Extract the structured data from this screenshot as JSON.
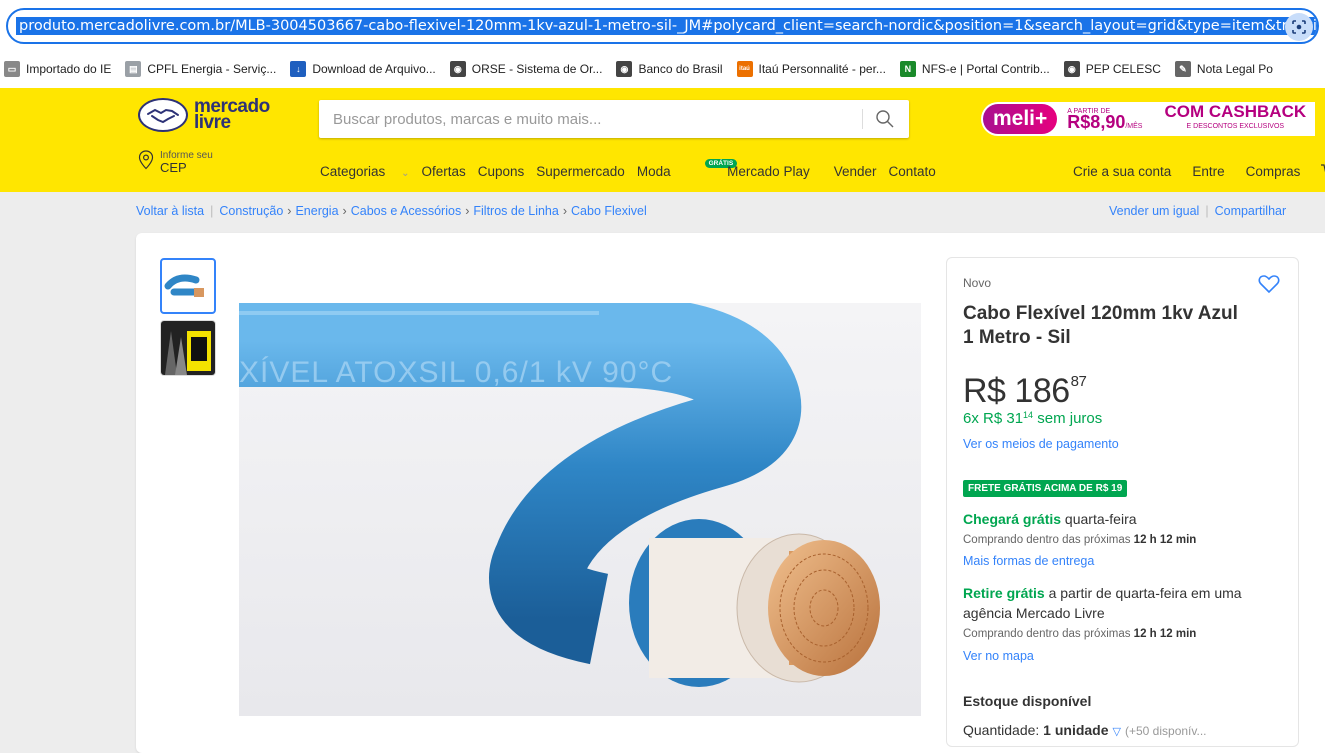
{
  "browser": {
    "url_start": "produto.mercadolivre.com.br/MLB-3004503667-cabo-flexivel-120mm-1kv-azul-1-metro-sil-_JM#polycard_client=search-nordic&position=1&search_layout=grid&type=item&tracking",
    "bookmarks": [
      {
        "label": "Importado do IE",
        "icon": "folder-icon",
        "color": "#888888"
      },
      {
        "label": "CPFL Energia - Serviç...",
        "icon": "page-icon",
        "color": "#9aa0a6"
      },
      {
        "label": "Download de Arquivo...",
        "icon": "download-icon",
        "color": "#1f5fbf"
      },
      {
        "label": "ORSE - Sistema de Or...",
        "icon": "globe-icon",
        "color": "#444444"
      },
      {
        "label": "Banco do Brasil",
        "icon": "globe-icon",
        "color": "#444444"
      },
      {
        "label": "Itaú Personnalité - per...",
        "icon": "itau-icon",
        "color": "#ec7000"
      },
      {
        "label": "NFS-e | Portal Contrib...",
        "icon": "nfse-icon",
        "color": "#1a8a2a"
      },
      {
        "label": "PEP CELESC",
        "icon": "globe-icon",
        "color": "#444444"
      },
      {
        "label": "Nota Legal Po",
        "icon": "nota-icon",
        "color": "#666666"
      }
    ]
  },
  "header": {
    "logo_line1": "mercado",
    "logo_line2": "livre",
    "search_placeholder": "Buscar produtos, marcas e muito mais...",
    "meli": {
      "tag": "meli+",
      "from": "A PARTIR DE",
      "price": "R$8,90",
      "per": "/MÊS",
      "cashback": "COM CASHBACK",
      "extra": "E DESCONTOS EXCLUSIVOS"
    },
    "cep_line1": "Informe seu",
    "cep_line2": "CEP",
    "nav": [
      "Categorias",
      "Ofertas",
      "Cupons",
      "Supermercado",
      "Moda",
      "Mercado Play",
      "Vender",
      "Contato"
    ],
    "gratis_badge": "GRÁTIS",
    "account": [
      "Crie a sua conta",
      "Entre",
      "Compras"
    ]
  },
  "breadcrumb": {
    "back": "Voltar à lista",
    "path": [
      "Construção",
      "Energia",
      "Cabos e Acessórios",
      "Filtros de Linha",
      "Cabo Flexivel"
    ],
    "sell_same": "Vender um igual",
    "share": "Compartilhar"
  },
  "product": {
    "image_text": "XÍVEL ATOXSIL 0,6/1 kV 90°C",
    "condition": "Novo",
    "title": "Cabo Flexível 120mm 1kv Azul 1 Metro - Sil",
    "price_int": "R$ 186",
    "price_cents": "87",
    "installments_pre": "6x R$ 31",
    "installments_cents": "14",
    "installments_post": " sem juros",
    "payment_link": "Ver os meios de pagamento",
    "frete_badge": "FRETE GRÁTIS ACIMA DE R$ 19",
    "delivery_green": "Chegará grátis",
    "delivery_day": " quarta-feira",
    "delivery_note_pre": "Comprando dentro das próximas ",
    "delivery_note_time": "12 h 12 min",
    "more_delivery": "Mais formas de entrega",
    "pickup_green": "Retire grátis",
    "pickup_text": " a partir de quarta-feira em uma agência Mercado Livre",
    "pickup_note_pre": "Comprando dentro das próximas ",
    "pickup_note_time": "12 h 12 min",
    "map_link": "Ver no mapa",
    "stock": "Estoque disponível",
    "qty_label": "Quantidade: ",
    "qty_value": "1 unidade",
    "qty_available": "(+50 disponív..."
  },
  "colors": {
    "ml_yellow": "#ffe600",
    "ml_blue": "#3483fa",
    "ml_green": "#00a650",
    "cable_blue": "#2f86c6"
  }
}
